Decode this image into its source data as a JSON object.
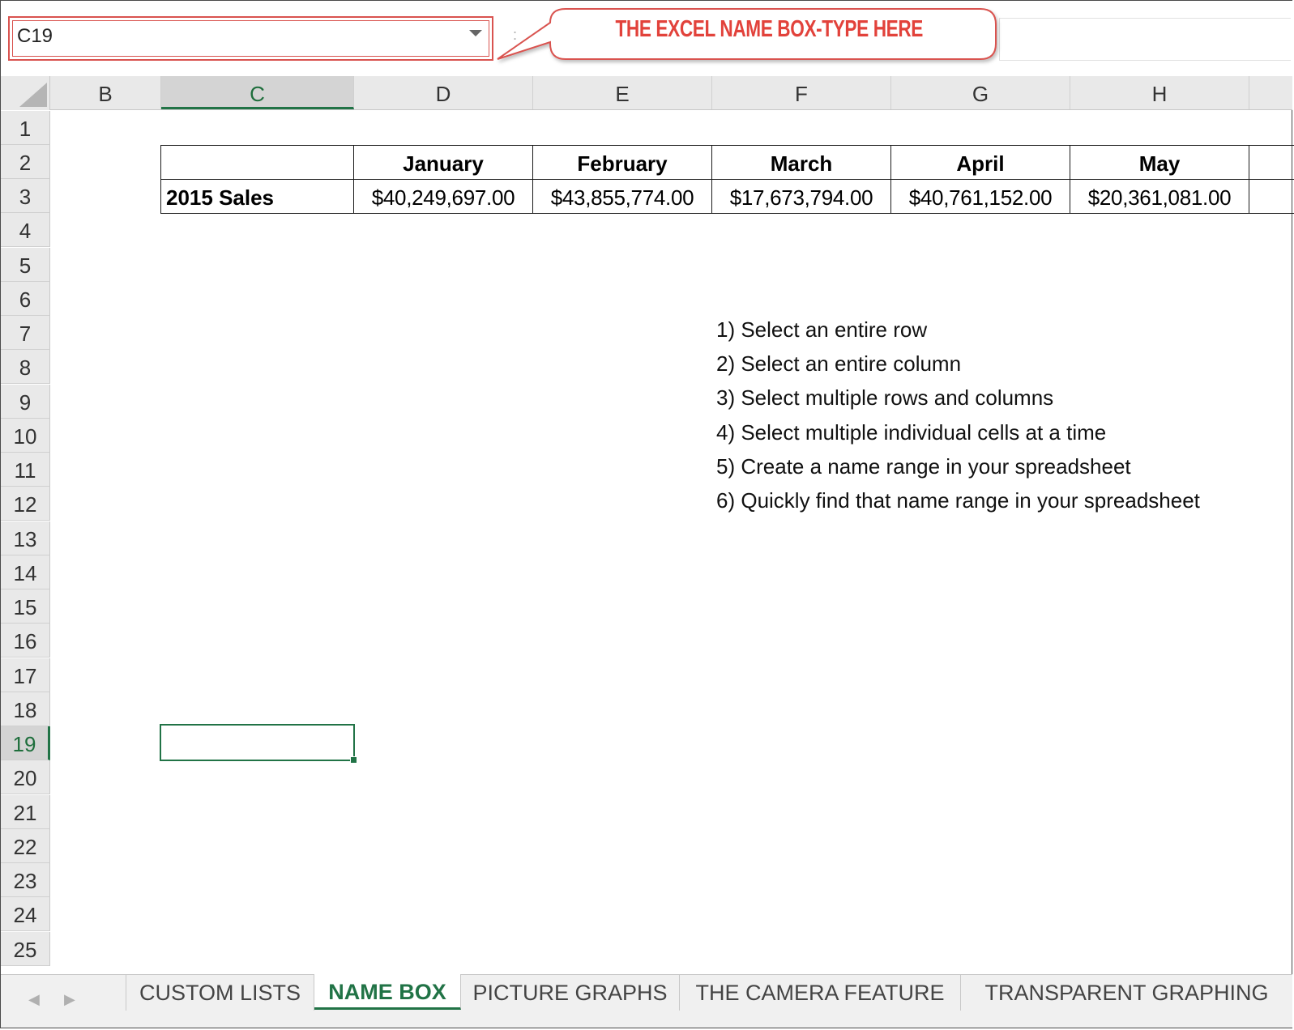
{
  "name_box": {
    "value": "C19"
  },
  "formula_bar": {
    "fx_separator": ":"
  },
  "callout": {
    "text": "THE EXCEL NAME BOX-TYPE HERE"
  },
  "columns": [
    "B",
    "C",
    "D",
    "E",
    "F",
    "G",
    "H"
  ],
  "active_column": "C",
  "rows": [
    "1",
    "2",
    "3",
    "4",
    "5",
    "6",
    "7",
    "8",
    "9",
    "10",
    "11",
    "12",
    "13",
    "14",
    "15",
    "16",
    "17",
    "18",
    "19",
    "20",
    "21",
    "22",
    "23",
    "24",
    "25"
  ],
  "active_row": "19",
  "sales_table": {
    "months": [
      "January",
      "February",
      "March",
      "April",
      "May"
    ],
    "row_label": "2015 Sales",
    "values": [
      "$40,249,697.00",
      "$43,855,774.00",
      "$17,673,794.00",
      "$40,761,152.00",
      "$20,361,081.00"
    ]
  },
  "steps": [
    "1) Select an entire row",
    "2) Select an entire column",
    "3) Select multiple rows and columns",
    "4) Select multiple individual cells at a time",
    "5) Create a name range in your spreadsheet",
    "6) Quickly find that name range in your spreadsheet"
  ],
  "sheet_tabs": [
    "CUSTOM LISTS",
    "NAME BOX",
    "PICTURE GRAPHS",
    "THE CAMERA FEATURE",
    "TRANSPARENT GRAPHING"
  ],
  "active_tab": "NAME BOX",
  "colors": {
    "accent": "#217346",
    "callout": "#e2423b",
    "namebox_border": "#d9534f"
  }
}
